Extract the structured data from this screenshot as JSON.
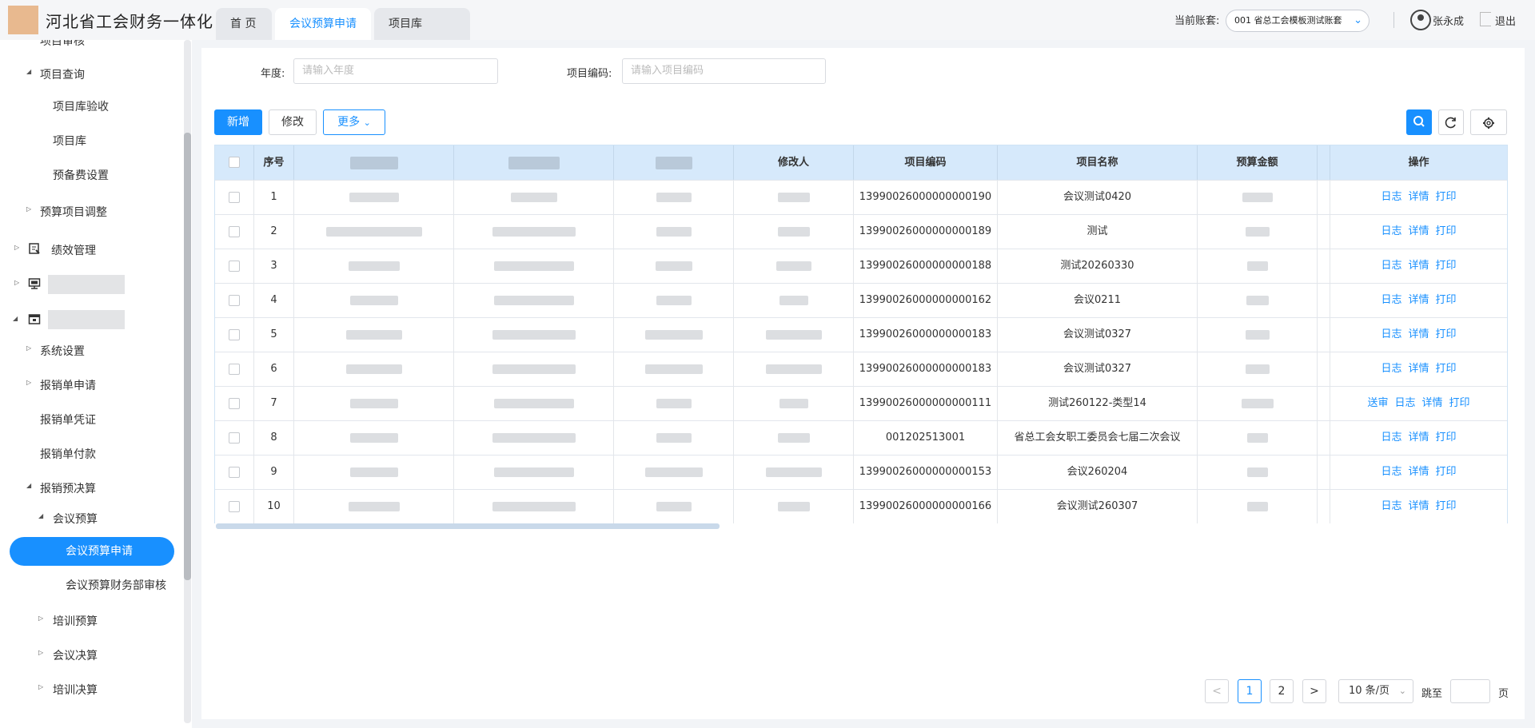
{
  "header": {
    "app_title": "河北省工会财务一体化",
    "tabs": [
      "首 页",
      "会议预算申请",
      "项目库"
    ],
    "active_tab": "会议预算申请",
    "account_label": "当前账套:",
    "account_value": "001 省总工会模板测试账套",
    "user_name": "张永成",
    "logout": "退出"
  },
  "sidebar": {
    "items": [
      {
        "label": "项目审核"
      },
      {
        "label": "项目查询"
      },
      {
        "label": "项目库验收"
      },
      {
        "label": "项目库"
      },
      {
        "label": "预备费设置"
      },
      {
        "label": "预算项目调整"
      },
      {
        "label": "绩效管理"
      },
      {
        "label": "系统设置"
      },
      {
        "label": "报销单申请"
      },
      {
        "label": "报销单凭证"
      },
      {
        "label": "报销单付款"
      },
      {
        "label": "报销预决算"
      },
      {
        "label": "会议预算"
      },
      {
        "label": "会议预算申请"
      },
      {
        "label": "会议预算财务部审核"
      },
      {
        "label": "培训预算"
      },
      {
        "label": "会议决算"
      },
      {
        "label": "培训决算"
      }
    ]
  },
  "filters": {
    "year_label": "年度:",
    "year_placeholder": "请输入年度",
    "code_label": "项目编码:",
    "code_placeholder": "请输入项目编码"
  },
  "toolbar": {
    "add_label": "新增",
    "edit_label": "修改",
    "more_label": "更多"
  },
  "table": {
    "headers": {
      "index": "序号",
      "modifier": "修改人",
      "code": "项目编码",
      "name": "项目名称",
      "amount": "预算金额",
      "actions": "操作"
    },
    "rows": [
      {
        "index": "1",
        "code": "13990026000000000190",
        "name": "会议测试0420",
        "actions": [
          "日志",
          "详情",
          "打印"
        ]
      },
      {
        "index": "2",
        "code": "13990026000000000189",
        "name": "测试",
        "actions": [
          "日志",
          "详情",
          "打印"
        ]
      },
      {
        "index": "3",
        "code": "13990026000000000188",
        "name": "测试20260330",
        "actions": [
          "日志",
          "详情",
          "打印"
        ]
      },
      {
        "index": "4",
        "code": "13990026000000000162",
        "name": "会议0211",
        "actions": [
          "日志",
          "详情",
          "打印"
        ]
      },
      {
        "index": "5",
        "code": "13990026000000000183",
        "name": "会议测试0327",
        "actions": [
          "日志",
          "详情",
          "打印"
        ]
      },
      {
        "index": "6",
        "code": "13990026000000000183",
        "name": "会议测试0327",
        "actions": [
          "日志",
          "详情",
          "打印"
        ]
      },
      {
        "index": "7",
        "code": "13990026000000000111",
        "name": "测试260122-类型14",
        "actions": [
          "送审",
          "日志",
          "详情",
          "打印"
        ]
      },
      {
        "index": "8",
        "code": "001202513001",
        "name": "省总工会女职工委员会七届二次会议",
        "actions": [
          "日志",
          "详情",
          "打印"
        ]
      },
      {
        "index": "9",
        "code": "13990026000000000153",
        "name": "会议260204",
        "actions": [
          "日志",
          "详情",
          "打印"
        ]
      },
      {
        "index": "10",
        "code": "13990026000000000166",
        "name": "会议测试260307",
        "actions": [
          "日志",
          "详情",
          "打印"
        ]
      }
    ]
  },
  "pagination": {
    "prev": "<",
    "pages": [
      "1",
      "2"
    ],
    "next": ">",
    "page_size": "10 条/页",
    "jump_label": "跳至",
    "page_suffix": "页"
  }
}
